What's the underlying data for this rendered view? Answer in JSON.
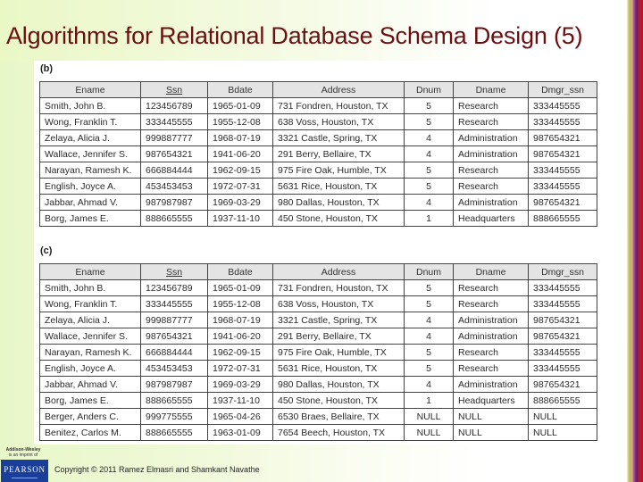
{
  "slide": {
    "title": "Algorithms for Relational Database Schema Design (5)",
    "copyright": "Copyright © 2011 Ramez Elmasri and Shamkant Navathe",
    "publisher": {
      "name": "Addison-Wesley",
      "tagline": "is an imprint of",
      "logo_text": "PEARSON"
    }
  },
  "tables": {
    "b": {
      "label": "(b)",
      "columns": [
        {
          "name": "Ename",
          "key": false
        },
        {
          "name": "Ssn",
          "key": true
        },
        {
          "name": "Bdate",
          "key": false
        },
        {
          "name": "Address",
          "key": false
        },
        {
          "name": "Dnum",
          "key": false
        },
        {
          "name": "Dname",
          "key": false
        },
        {
          "name": "Dmgr_ssn",
          "key": false
        }
      ],
      "rows": [
        [
          "Smith, John B.",
          "123456789",
          "1965-01-09",
          "731 Fondren, Houston, TX",
          "5",
          "Research",
          "333445555"
        ],
        [
          "Wong, Franklin T.",
          "333445555",
          "1955-12-08",
          "638 Voss, Houston, TX",
          "5",
          "Research",
          "333445555"
        ],
        [
          "Zelaya, Alicia J.",
          "999887777",
          "1968-07-19",
          "3321 Castle, Spring, TX",
          "4",
          "Administration",
          "987654321"
        ],
        [
          "Wallace, Jennifer S.",
          "987654321",
          "1941-06-20",
          "291 Berry, Bellaire, TX",
          "4",
          "Administration",
          "987654321"
        ],
        [
          "Narayan, Ramesh K.",
          "666884444",
          "1962-09-15",
          "975 Fire Oak, Humble, TX",
          "5",
          "Research",
          "333445555"
        ],
        [
          "English, Joyce A.",
          "453453453",
          "1972-07-31",
          "5631 Rice, Houston, TX",
          "5",
          "Research",
          "333445555"
        ],
        [
          "Jabbar, Ahmad V.",
          "987987987",
          "1969-03-29",
          "980 Dallas, Houston, TX",
          "4",
          "Administration",
          "987654321"
        ],
        [
          "Borg, James E.",
          "888665555",
          "1937-11-10",
          "450 Stone, Houston, TX",
          "1",
          "Headquarters",
          "888665555"
        ]
      ]
    },
    "c": {
      "label": "(c)",
      "columns": [
        {
          "name": "Ename",
          "key": false
        },
        {
          "name": "Ssn",
          "key": true
        },
        {
          "name": "Bdate",
          "key": false
        },
        {
          "name": "Address",
          "key": false
        },
        {
          "name": "Dnum",
          "key": false
        },
        {
          "name": "Dname",
          "key": false
        },
        {
          "name": "Dmgr_ssn",
          "key": false
        }
      ],
      "rows": [
        [
          "Smith, John B.",
          "123456789",
          "1965-01-09",
          "731 Fondren, Houston, TX",
          "5",
          "Research",
          "333445555"
        ],
        [
          "Wong, Franklin T.",
          "333445555",
          "1955-12-08",
          "638 Voss, Houston, TX",
          "5",
          "Research",
          "333445555"
        ],
        [
          "Zelaya, Alicia J.",
          "999887777",
          "1968-07-19",
          "3321 Castle, Spring, TX",
          "4",
          "Administration",
          "987654321"
        ],
        [
          "Wallace, Jennifer S.",
          "987654321",
          "1941-06-20",
          "291 Berry, Bellaire, TX",
          "4",
          "Administration",
          "987654321"
        ],
        [
          "Narayan, Ramesh K.",
          "666884444",
          "1962-09-15",
          "975 Fire Oak, Humble, TX",
          "5",
          "Research",
          "333445555"
        ],
        [
          "English, Joyce A.",
          "453453453",
          "1972-07-31",
          "5631 Rice, Houston, TX",
          "5",
          "Research",
          "333445555"
        ],
        [
          "Jabbar, Ahmad V.",
          "987987987",
          "1969-03-29",
          "980 Dallas, Houston, TX",
          "4",
          "Administration",
          "987654321"
        ],
        [
          "Borg, James E.",
          "888665555",
          "1937-11-10",
          "450 Stone, Houston, TX",
          "1",
          "Headquarters",
          "888665555"
        ],
        [
          "Berger, Anders C.",
          "999775555",
          "1965-04-26",
          "6530 Braes, Bellaire, TX",
          "NULL",
          "NULL",
          "NULL"
        ],
        [
          "Benitez, Carlos M.",
          "888665555",
          "1963-01-09",
          "7654 Beech, Houston, TX",
          "NULL",
          "NULL",
          "NULL"
        ]
      ]
    }
  },
  "colors": {
    "title": "#6b0f12",
    "header_fill": "#e4e4e4",
    "publisher_logo": "#1a3f9a"
  }
}
